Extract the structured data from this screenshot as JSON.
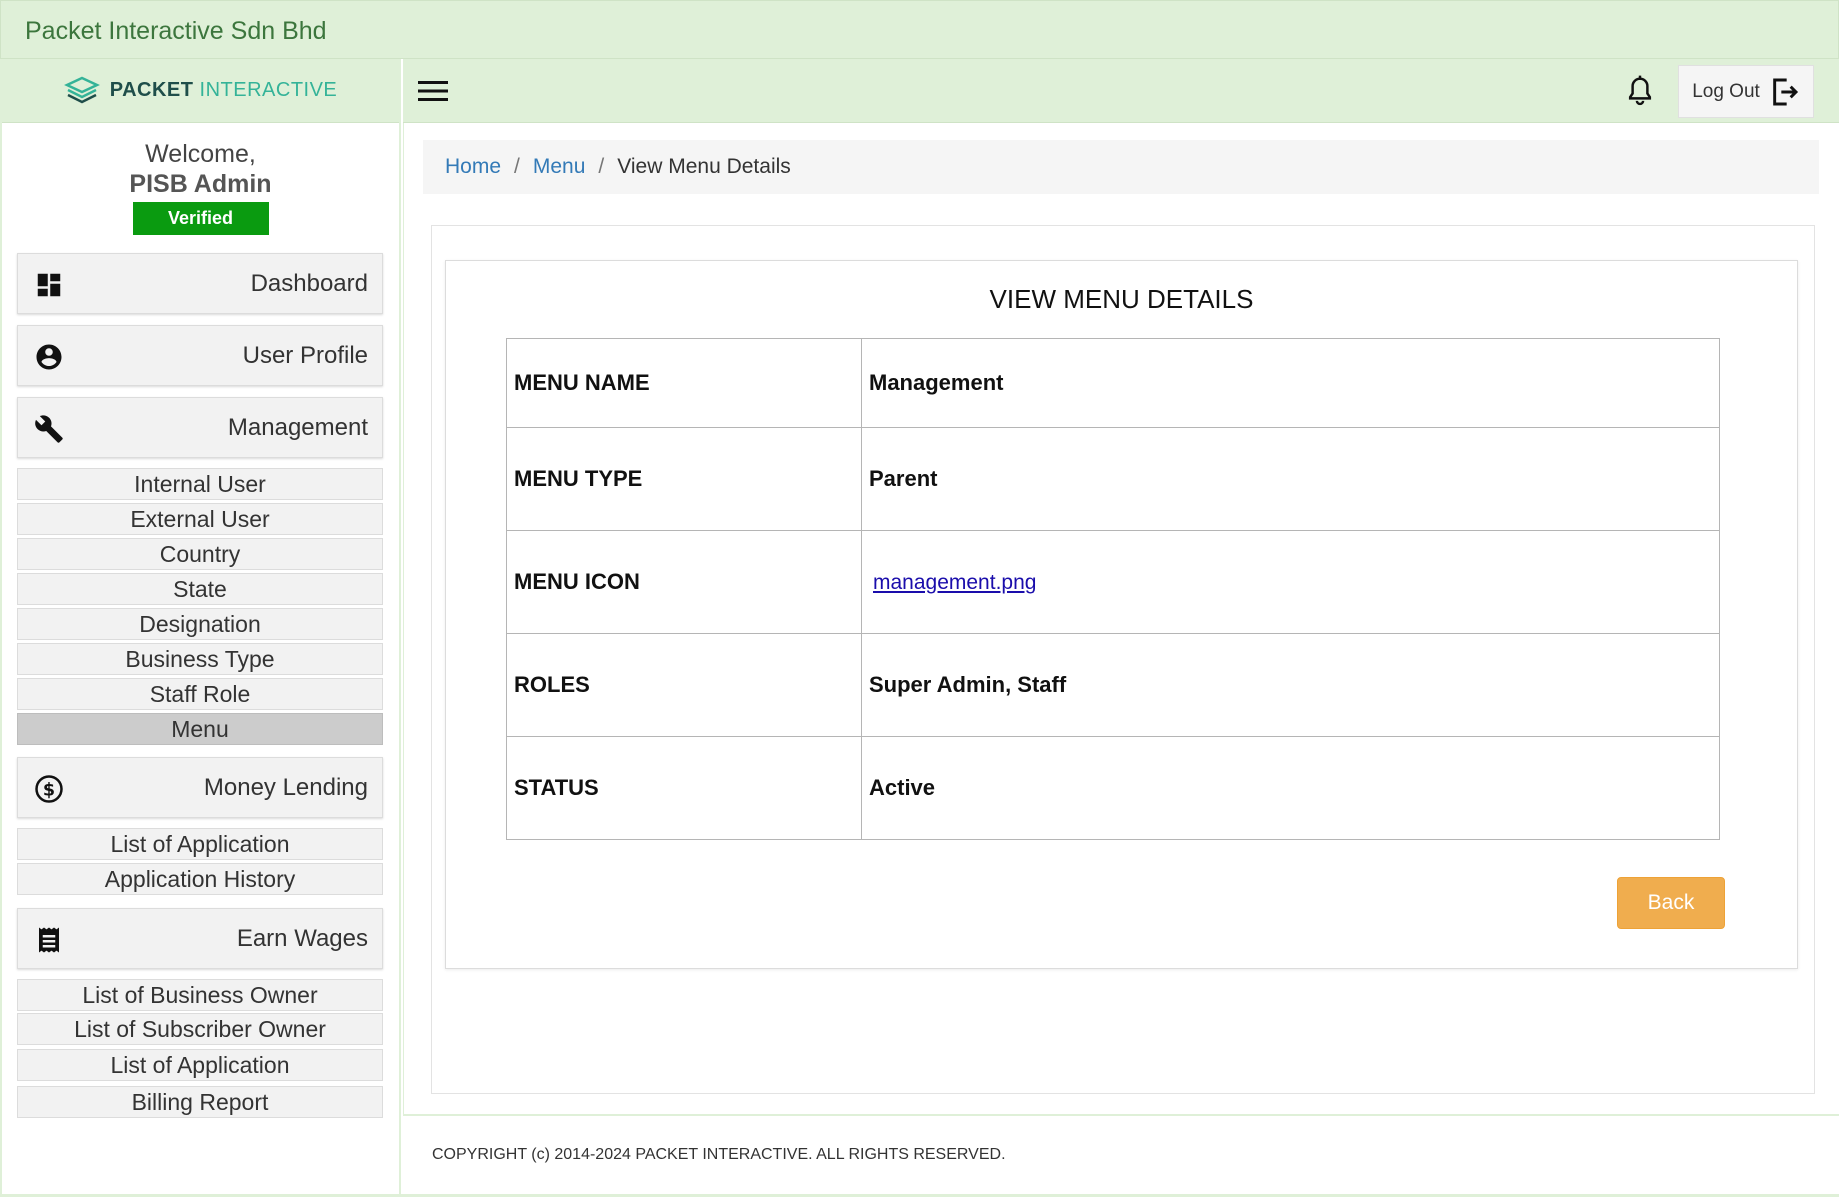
{
  "company_name": "Packet Interactive Sdn Bhd",
  "logo": {
    "text_bold": "PACKET",
    "text_light": "INTERACTIVE",
    "icon": "layers-logo-icon"
  },
  "user": {
    "welcome": "Welcome,",
    "name": "PISB Admin",
    "badge": "Verified"
  },
  "sidebar": {
    "sections": [
      {
        "label": "Dashboard",
        "icon": "dashboard-icon"
      },
      {
        "label": "User Profile",
        "icon": "account-circle-icon"
      },
      {
        "label": "Management",
        "icon": "wrench-icon",
        "items": [
          "Internal User",
          "External User",
          "Country",
          "State",
          "Designation",
          "Business Type",
          "Staff Role",
          "Menu"
        ],
        "active_item": "Menu"
      },
      {
        "label": "Money Lending",
        "icon": "dollar-circle-icon",
        "items": [
          "List of Application",
          "Application History"
        ]
      },
      {
        "label": "Earn Wages",
        "icon": "receipt-icon",
        "items": [
          "List of Business Owner",
          "List of Subscriber Owner",
          "List of Application",
          "Billing Report"
        ]
      }
    ]
  },
  "navbar": {
    "logout_label": "Log Out",
    "menu_icon": "hamburger-menu-icon",
    "notification_icon": "bell-icon",
    "logout_icon": "logout-icon"
  },
  "breadcrumb": {
    "items": [
      "Home",
      "Menu"
    ],
    "current": "View Menu Details"
  },
  "details": {
    "title": "VIEW MENU DETAILS",
    "rows": [
      {
        "key": "MENU NAME",
        "value": "Management"
      },
      {
        "key": "MENU TYPE",
        "value": "Parent"
      },
      {
        "key": "MENU ICON",
        "value": "management.png"
      },
      {
        "key": "ROLES",
        "value": "Super Admin, Staff"
      },
      {
        "key": "STATUS",
        "value": "Active"
      }
    ],
    "back_label": "Back"
  },
  "footer": "COPYRIGHT (c) 2014-2024 PACKET INTERACTIVE. ALL RIGHTS RESERVED.",
  "colors": {
    "header_bg": "#dff0d8",
    "verified": "#0a9b10",
    "back_button": "#f0ad4e",
    "link": "#337ab7"
  }
}
